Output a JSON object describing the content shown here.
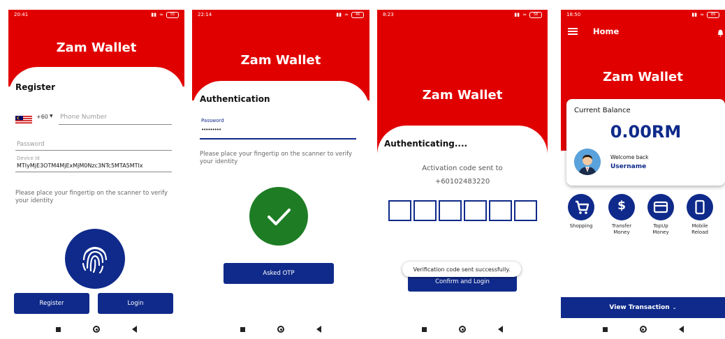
{
  "app": {
    "brand": "Zam Wallet"
  },
  "screen1": {
    "status_time": "20:41",
    "battery": "55",
    "heading": "Register",
    "country_code": "+60",
    "phone_placeholder": "Phone Number",
    "password_placeholder": "Password",
    "device_id_label": "Device Id",
    "device_id_value": "MTIyMjE3OTM4MjExMjM0Nzc3NTc5MTA5MTIx",
    "hint": "Please place your fingertip on the scanner to verify your identity",
    "register_label": "Register",
    "login_label": "Login"
  },
  "screen2": {
    "status_time": "22:14",
    "battery": "46",
    "heading": "Authentication",
    "password_label": "Password",
    "password_value": "•••••••••",
    "hint": "Please place your fingertip on the scanner to verify your identity",
    "otp_label": "Asked OTP"
  },
  "screen3": {
    "status_time": "8:23",
    "battery": "58",
    "heading": "Authenticating....",
    "activation_line1": "Activation code sent to",
    "activation_line2": "+60102483220",
    "otp_boxes": [
      "",
      "",
      "",
      "",
      "",
      ""
    ],
    "confirm_label": "Confirm and Login",
    "toast": "Verification code sent successfully."
  },
  "screen4": {
    "status_time": "18:50",
    "battery": "89",
    "title": "Home",
    "balance_label": "Current Balance",
    "balance_value": "0.00RM",
    "welcome": "Welcome back",
    "username": "Username",
    "actions": [
      {
        "line1": "Shopping",
        "line2": ""
      },
      {
        "line1": "Transfer",
        "line2": "Money"
      },
      {
        "line1": "TopUp",
        "line2": "Money"
      },
      {
        "line1": "Mobile",
        "line2": "Reload"
      }
    ],
    "view_transaction": "View Transaction"
  },
  "colors": {
    "brand_red": "#e10000",
    "navy": "#0f2a8a",
    "success_green": "#1e7d24"
  }
}
